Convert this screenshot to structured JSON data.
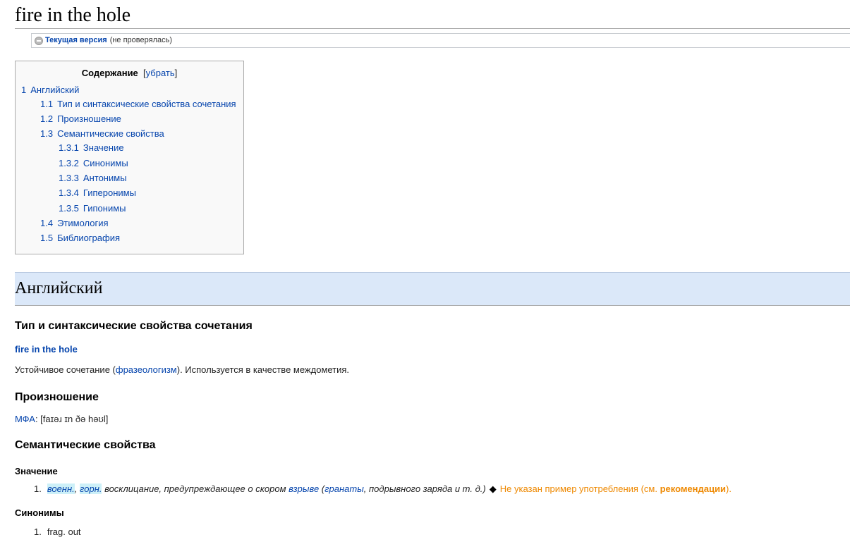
{
  "page": {
    "title": "fire in the hole"
  },
  "flagged_revs": {
    "current_label": "Текущая версия",
    "status": "(не проверялась)"
  },
  "toc": {
    "title": "Содержание",
    "toggle": "[убрать]",
    "items": [
      {
        "num": "1",
        "label": "Английский"
      },
      {
        "num": "1.1",
        "label": "Тип и синтаксические свойства сочетания"
      },
      {
        "num": "1.2",
        "label": "Произношение"
      },
      {
        "num": "1.3",
        "label": "Семантические свойства"
      },
      {
        "num": "1.3.1",
        "label": "Значение"
      },
      {
        "num": "1.3.2",
        "label": "Синонимы"
      },
      {
        "num": "1.3.3",
        "label": "Антонимы"
      },
      {
        "num": "1.3.4",
        "label": "Гиперонимы"
      },
      {
        "num": "1.3.5",
        "label": "Гипонимы"
      },
      {
        "num": "1.4",
        "label": "Этимология"
      },
      {
        "num": "1.5",
        "label": "Библиография"
      }
    ]
  },
  "language": {
    "heading": "Английский"
  },
  "type_section": {
    "heading": "Тип и синтаксические свойства сочетания",
    "headword": "fire in the hole",
    "desc_before": "Устойчивое сочетание (",
    "desc_link": "фразеологизм",
    "desc_after": "). Используется в качестве междометия."
  },
  "pronunciation": {
    "heading": "Произношение",
    "ipa_link": "МФА",
    "ipa_text": ": [faɪəɹ ɪn ðə həʊl]"
  },
  "semantic": {
    "heading": "Семантические свойства",
    "meaning": {
      "heading": "Значение",
      "num": "1.",
      "tag1": "военн.",
      "sep": ", ",
      "tag2": "горн.",
      "text1": " восклицание, предупреждающее о скором ",
      "link1": "взрыве",
      "text2": " (",
      "link2": "гранаты",
      "text3": ", подрывного заряда и т. д.)",
      "diamond": "◆",
      "warn_text": "Не указан пример употребления (см. ",
      "warn_link": "рекомендации",
      "warn_end": ")."
    },
    "synonyms": {
      "heading": "Синонимы",
      "num": "1.",
      "text": "frag. out"
    }
  }
}
